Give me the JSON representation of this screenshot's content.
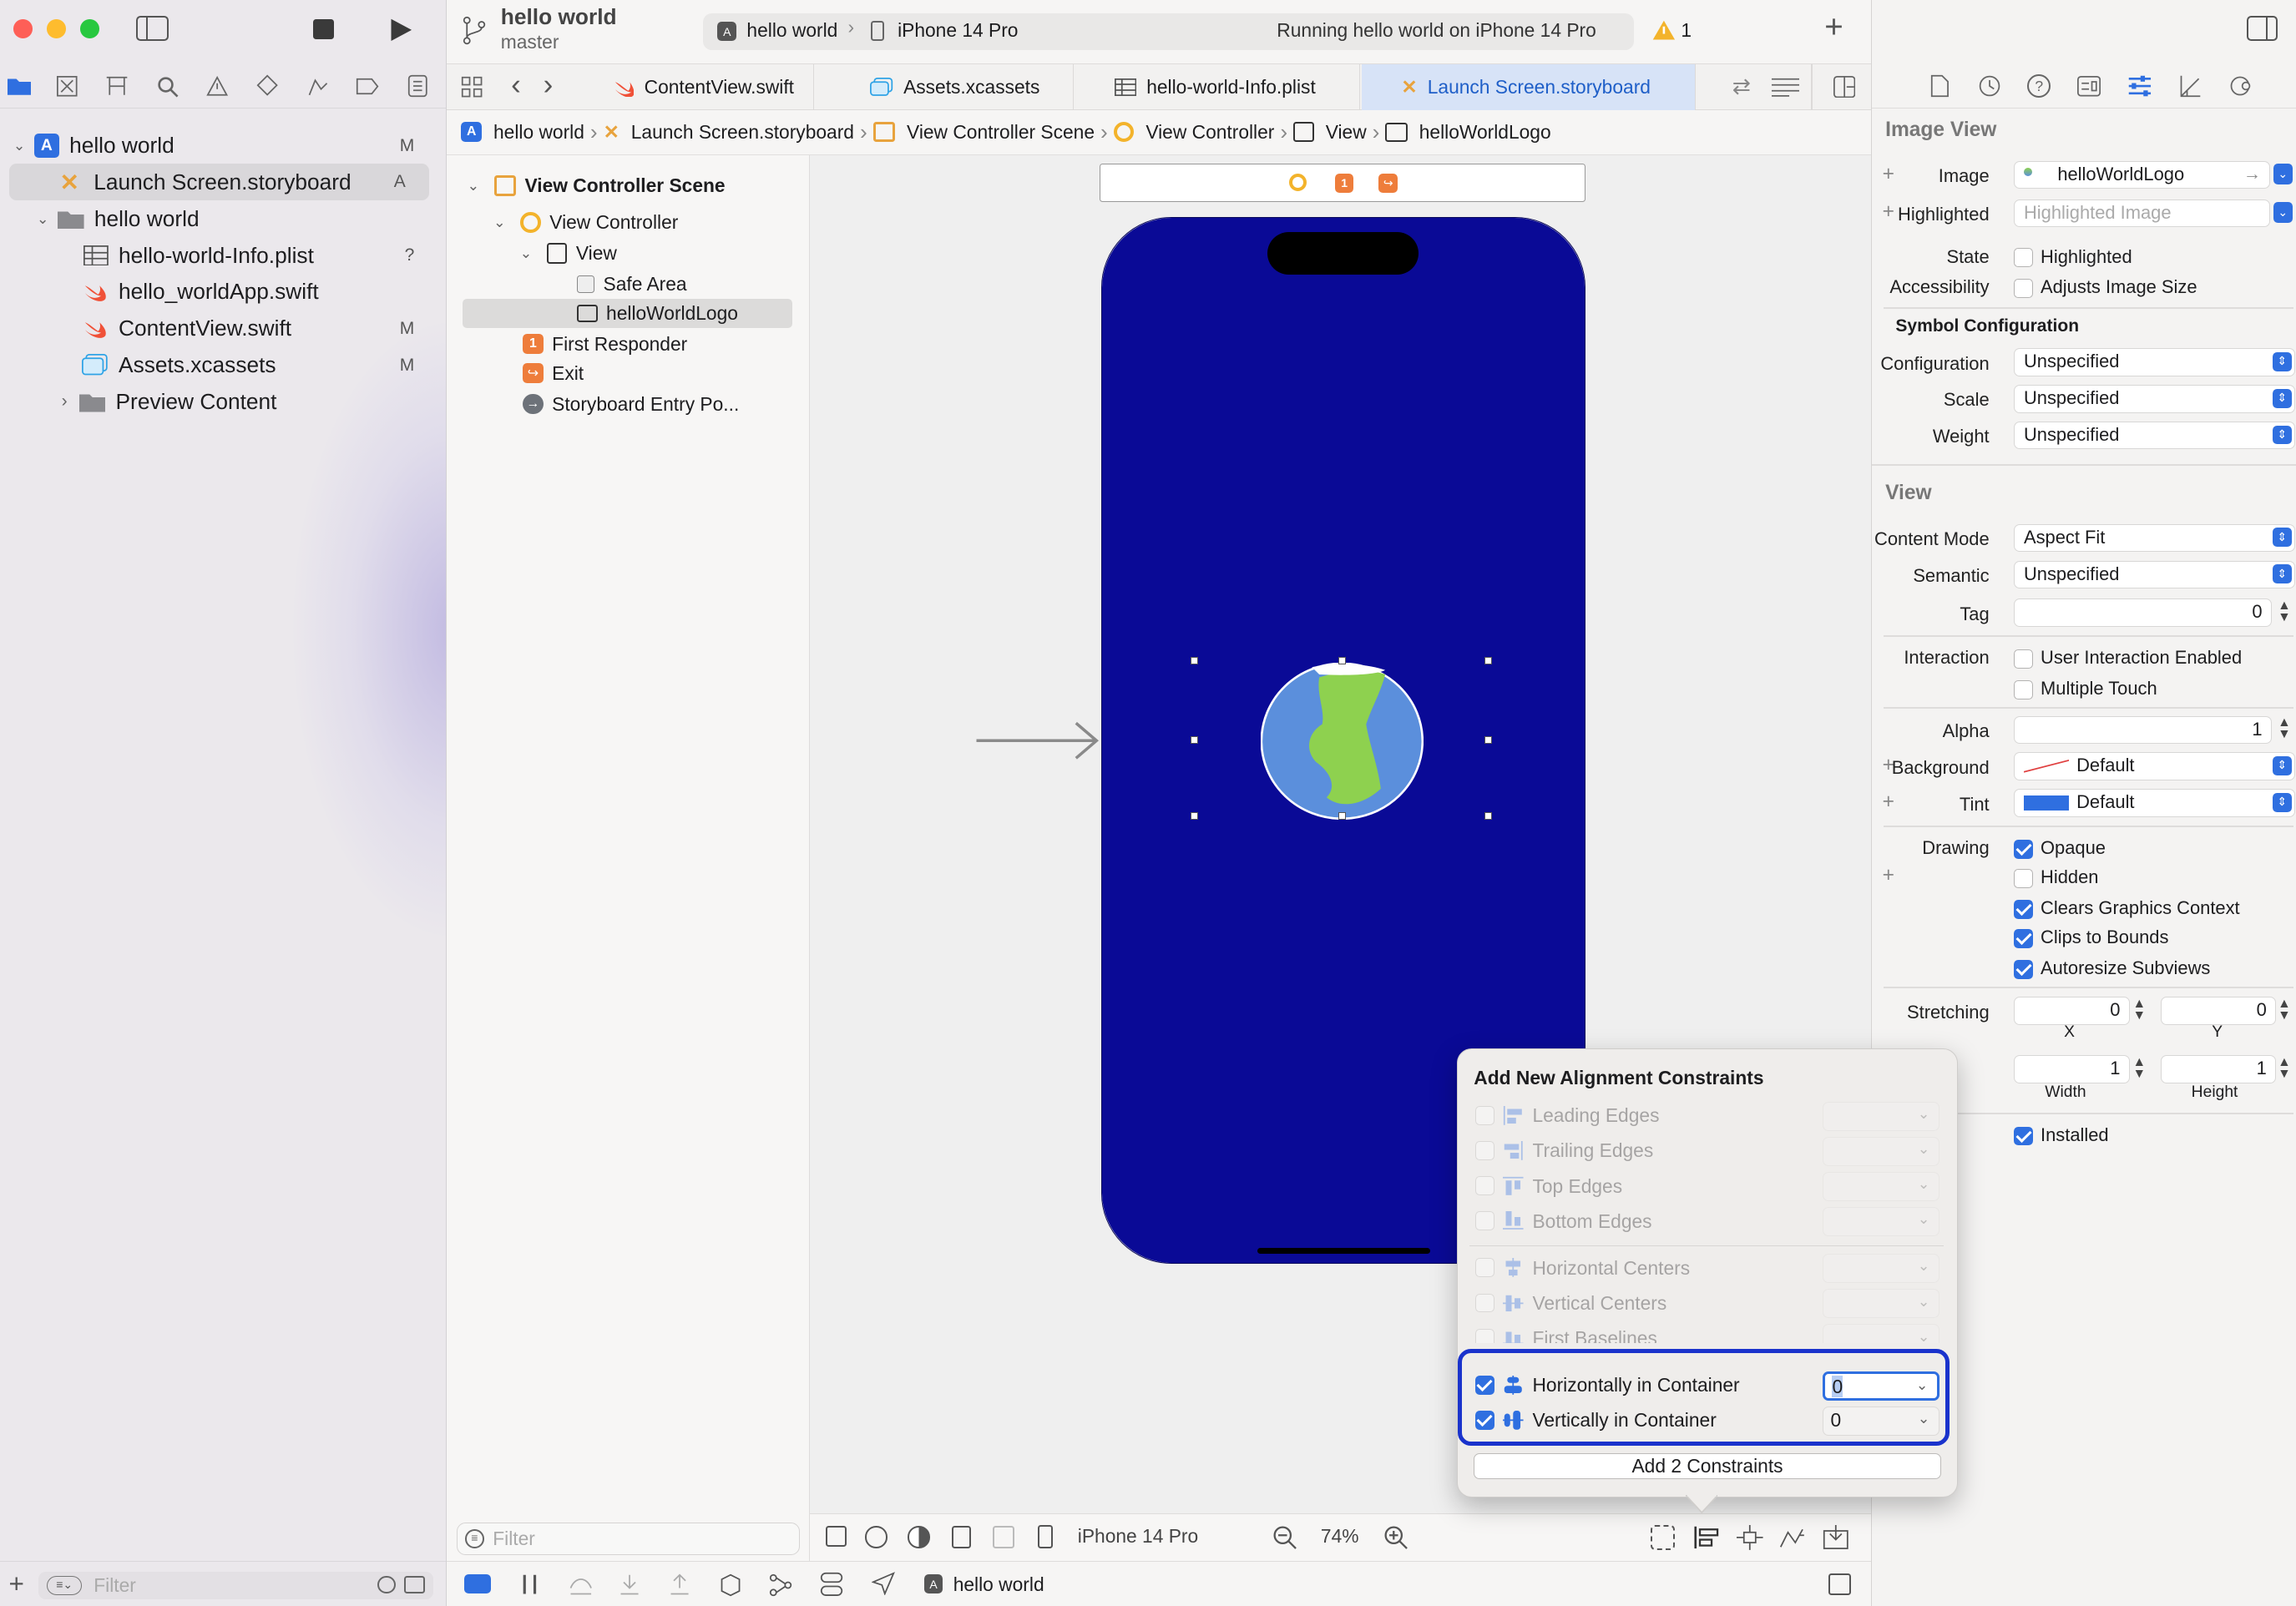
{
  "window": {
    "project": "hello world",
    "branch": "master"
  },
  "scheme": {
    "target": "hello world",
    "device": "iPhone 14 Pro",
    "status": "Running hello world on iPhone 14 Pro",
    "warnings": "1"
  },
  "navigator": {
    "items": [
      {
        "label": "hello world",
        "badge": "M"
      },
      {
        "label": "Launch Screen.storyboard",
        "badge": "A"
      },
      {
        "label": "hello world",
        "badge": ""
      },
      {
        "label": "hello-world-Info.plist",
        "badge": "?"
      },
      {
        "label": "hello_worldApp.swift",
        "badge": ""
      },
      {
        "label": "ContentView.swift",
        "badge": "M"
      },
      {
        "label": "Assets.xcassets",
        "badge": "M"
      },
      {
        "label": "Preview Content",
        "badge": ""
      }
    ],
    "filter_placeholder": "Filter"
  },
  "tabs": [
    "ContentView.swift",
    "Assets.xcassets",
    "hello-world-Info.plist",
    "Launch Screen.storyboard"
  ],
  "jumpbar": [
    "hello world",
    "Launch Screen.storyboard",
    "View Controller Scene",
    "View Controller",
    "View",
    "helloWorldLogo"
  ],
  "outline": {
    "items": [
      "View Controller Scene",
      "View Controller",
      "View",
      "Safe Area",
      "helloWorldLogo",
      "First Responder",
      "Exit",
      "Storyboard Entry Po..."
    ],
    "filter_placeholder": "Filter"
  },
  "canvasbar": {
    "device": "iPhone 14 Pro",
    "zoom": "74%"
  },
  "statusbar": {
    "target": "hello world"
  },
  "colors": {
    "accent": "#2f6fe0",
    "screen": "#0a0a96",
    "earth_water": "#5b8fdc",
    "earth_land": "#8ed14f"
  },
  "inspector": {
    "image_view_title": "Image View",
    "image_label": "Image",
    "image_value": "helloWorldLogo",
    "highlighted_label": "Highlighted",
    "highlighted_placeholder": "Highlighted Image",
    "state_label": "State",
    "state_value": "Highlighted",
    "accessibility_label": "Accessibility",
    "accessibility_value": "Adjusts Image Size",
    "symbol_config_title": "Symbol Configuration",
    "configuration_label": "Configuration",
    "configuration_value": "Unspecified",
    "scale_label": "Scale",
    "scale_value": "Unspecified",
    "weight_label": "Weight",
    "weight_value": "Unspecified",
    "view_title": "View",
    "content_mode_label": "Content Mode",
    "content_mode_value": "Aspect Fit",
    "semantic_label": "Semantic",
    "semantic_value": "Unspecified",
    "tag_label": "Tag",
    "tag_value": "0",
    "interaction_label": "Interaction",
    "user_interaction": "User Interaction Enabled",
    "multiple_touch": "Multiple Touch",
    "alpha_label": "Alpha",
    "alpha_value": "1",
    "background_label": "Background",
    "background_value": "Default",
    "tint_label": "Tint",
    "tint_value": "Default",
    "drawing_label": "Drawing",
    "opaque": "Opaque",
    "hidden": "Hidden",
    "clears": "Clears Graphics Context",
    "clips": "Clips to Bounds",
    "autoresize": "Autoresize Subviews",
    "stretching_label": "Stretching",
    "stretch_x": "0",
    "stretch_y": "0",
    "x_label": "X",
    "y_label": "Y",
    "stretch_w": "1",
    "stretch_h": "1",
    "width_label": "Width",
    "height_label": "Height",
    "installed": "Installed"
  },
  "popover": {
    "title": "Add New Alignment Constraints",
    "rows": [
      "Leading Edges",
      "Trailing Edges",
      "Top Edges",
      "Bottom Edges",
      "Horizontal Centers",
      "Vertical Centers",
      "First Baselines"
    ],
    "horiz_label": "Horizontally in Container",
    "horiz_value": "0",
    "vert_label": "Vertically in Container",
    "vert_value": "0",
    "button": "Add 2 Constraints"
  }
}
